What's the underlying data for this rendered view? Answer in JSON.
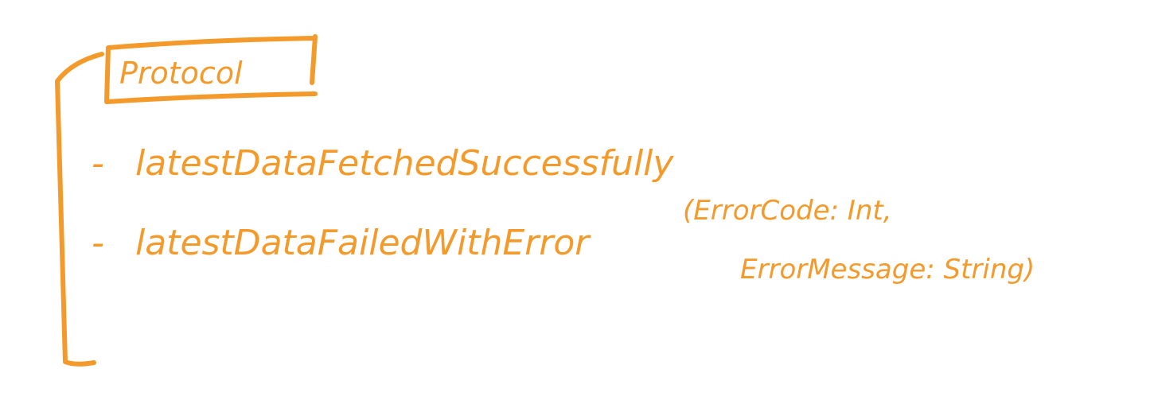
{
  "diagram": {
    "title": "Protocol",
    "items": [
      {
        "bullet": "-",
        "text": "latestDataFetchedSuccessfully"
      },
      {
        "bullet": "-",
        "text": "latestDataFailedWithError",
        "params": {
          "line1": "(ErrorCode: Int,",
          "line2": "ErrorMessage: String)"
        }
      }
    ],
    "ink_color": "#F39A2B",
    "background": "#FFFFFF"
  }
}
